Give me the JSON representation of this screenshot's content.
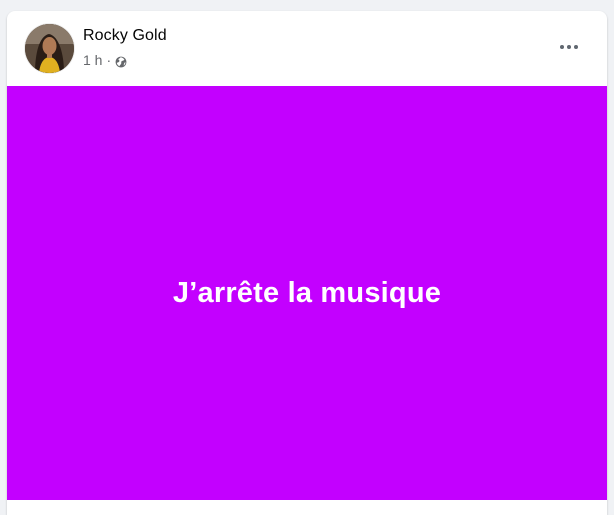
{
  "post": {
    "author": "Rocky Gold",
    "time": "1 h",
    "separator": "·",
    "privacy_icon": "globe-icon",
    "more_icon": "more-options-icon",
    "text": "J’arrête la musique",
    "background_color": "#c300ff",
    "text_color": "#ffffff"
  }
}
